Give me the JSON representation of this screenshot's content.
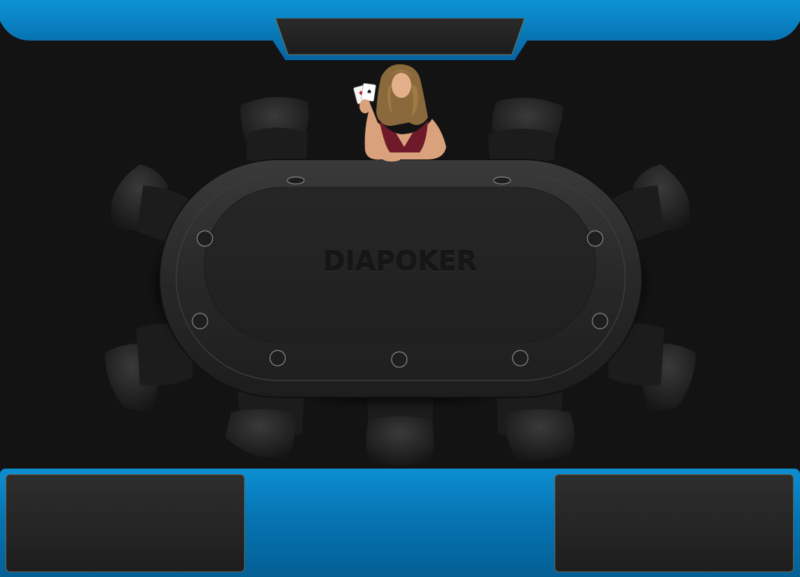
{
  "table": {
    "brand_text": "DIAPOKER",
    "seat_count": 10,
    "theme": {
      "accent": "#0a86c8",
      "accent_dark": "#045f94",
      "felt": "#222222",
      "rail": "#2f2f2f",
      "background": "#131313",
      "panel_border": "#6b6346"
    }
  },
  "dealer": {
    "card_icons": [
      "ace-of-diamonds-icon",
      "ace-of-spades-icon"
    ]
  }
}
